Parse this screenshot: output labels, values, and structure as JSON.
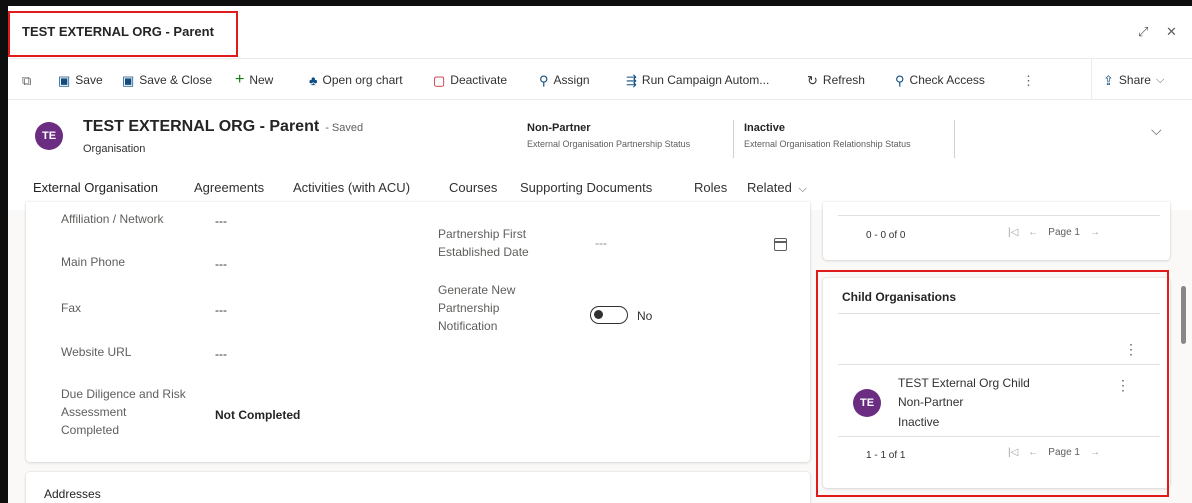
{
  "window": {
    "title": "TEST EXTERNAL ORG - Parent",
    "expand_icon": "expand-icon",
    "close_icon": "close-icon"
  },
  "commands": [
    {
      "label": "",
      "icon": "popout-icon",
      "glyph": "⧉"
    },
    {
      "label": "Save",
      "icon": "save-icon",
      "glyph": "▣"
    },
    {
      "label": "Save & Close",
      "icon": "save-close-icon",
      "glyph": "▣"
    },
    {
      "label": "New",
      "icon": "plus-icon",
      "glyph": "+"
    },
    {
      "label": "Open org chart",
      "icon": "org-chart-icon",
      "glyph": "♣"
    },
    {
      "label": "Deactivate",
      "icon": "deactivate-icon",
      "glyph": "▢"
    },
    {
      "label": "Assign",
      "icon": "assign-icon",
      "glyph": "⚲"
    },
    {
      "label": "Run Campaign Autom...",
      "icon": "flow-icon",
      "glyph": "⇶"
    },
    {
      "label": "Refresh",
      "icon": "refresh-icon",
      "glyph": "↻"
    },
    {
      "label": "Check Access",
      "icon": "check-access-icon",
      "glyph": "⚲"
    },
    {
      "label": "",
      "icon": "more-icon",
      "glyph": "⋮"
    },
    {
      "label": "Share",
      "icon": "share-icon",
      "glyph": "⇪"
    }
  ],
  "record": {
    "avatar_initials": "TE",
    "title": "TEST EXTERNAL ORG - Parent",
    "saved_status": "- Saved",
    "entity": "Organisation",
    "header_fields": [
      {
        "value": "Non-Partner",
        "label": "External Organisation Partnership Status"
      },
      {
        "value": "Inactive",
        "label": "External Organisation Relationship Status"
      }
    ]
  },
  "tabs": [
    "External Organisation",
    "Agreements",
    "Activities (with ACU)",
    "Courses",
    "Supporting Documents",
    "Roles",
    "Related"
  ],
  "form": {
    "left_fields": [
      {
        "label": "Affiliation / Network",
        "value": "---"
      },
      {
        "label": "Main Phone",
        "value": "---"
      },
      {
        "label": "Fax",
        "value": "---"
      },
      {
        "label": "Website URL",
        "value": "---"
      },
      {
        "label": "Due Diligence and Risk Assessment Completed",
        "value": "Not Completed"
      }
    ],
    "partnership_date_label": "Partnership First Established Date",
    "partnership_date_value": "---",
    "notification_label": "Generate New Partnership Notification",
    "notification_value": "No",
    "notification_on": false,
    "addresses_title": "Addresses"
  },
  "top_subgrid": {
    "count": "0 - 0 of 0",
    "page": "Page 1"
  },
  "child_orgs": {
    "title": "Child Organisations",
    "items": [
      {
        "initials": "TE",
        "name": "TEST External Org Child",
        "status1": "Non-Partner",
        "status2": "Inactive"
      }
    ],
    "count": "1 - 1 of 1",
    "page": "Page 1"
  },
  "colors": {
    "highlight": "#e01b1b",
    "avatar": "#6b2d82",
    "accent": "#0f6cbd"
  }
}
